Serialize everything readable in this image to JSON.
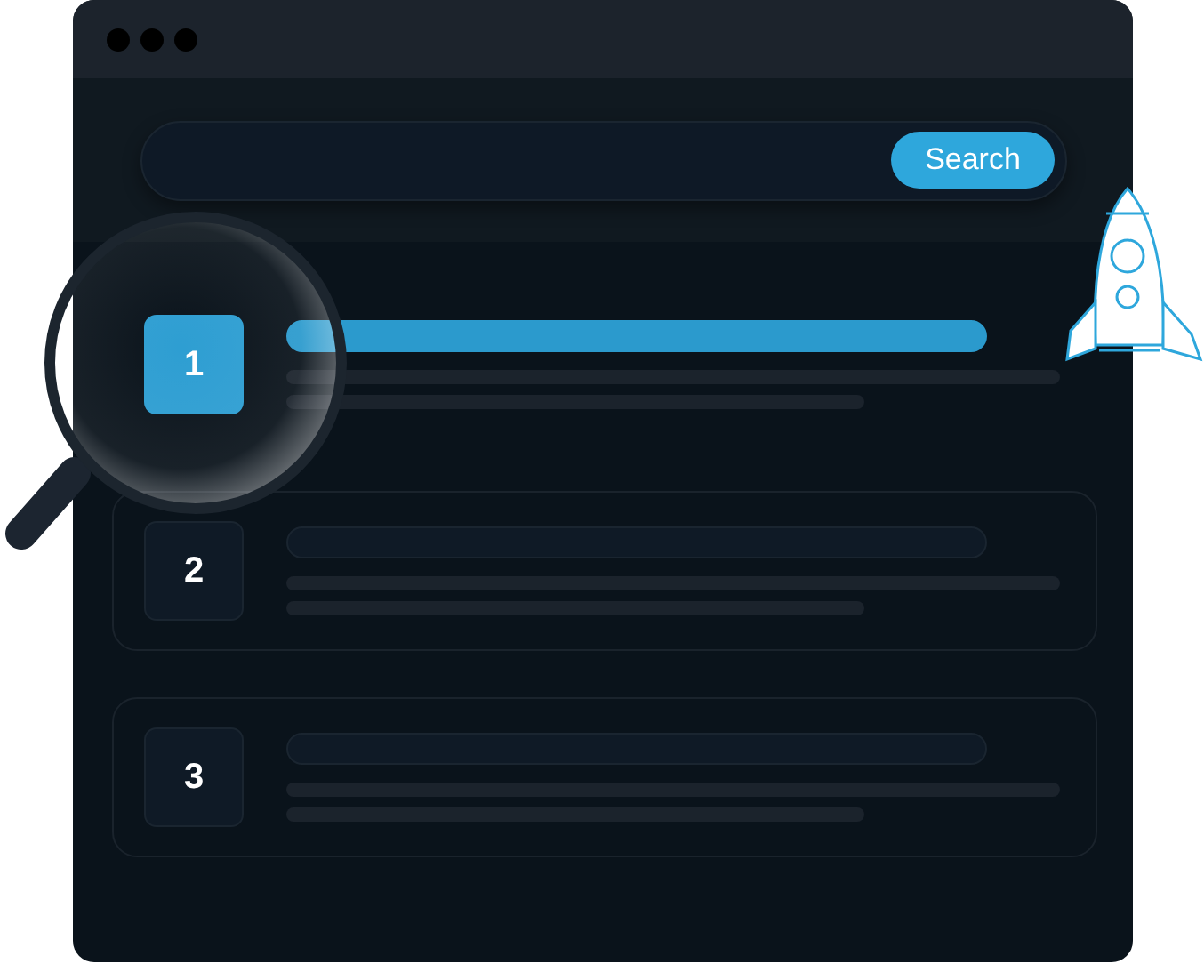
{
  "search": {
    "button": "Search"
  },
  "results": [
    {
      "number": "1",
      "selected": true
    },
    {
      "number": "2",
      "selected": false
    },
    {
      "number": "3",
      "selected": false
    }
  ]
}
